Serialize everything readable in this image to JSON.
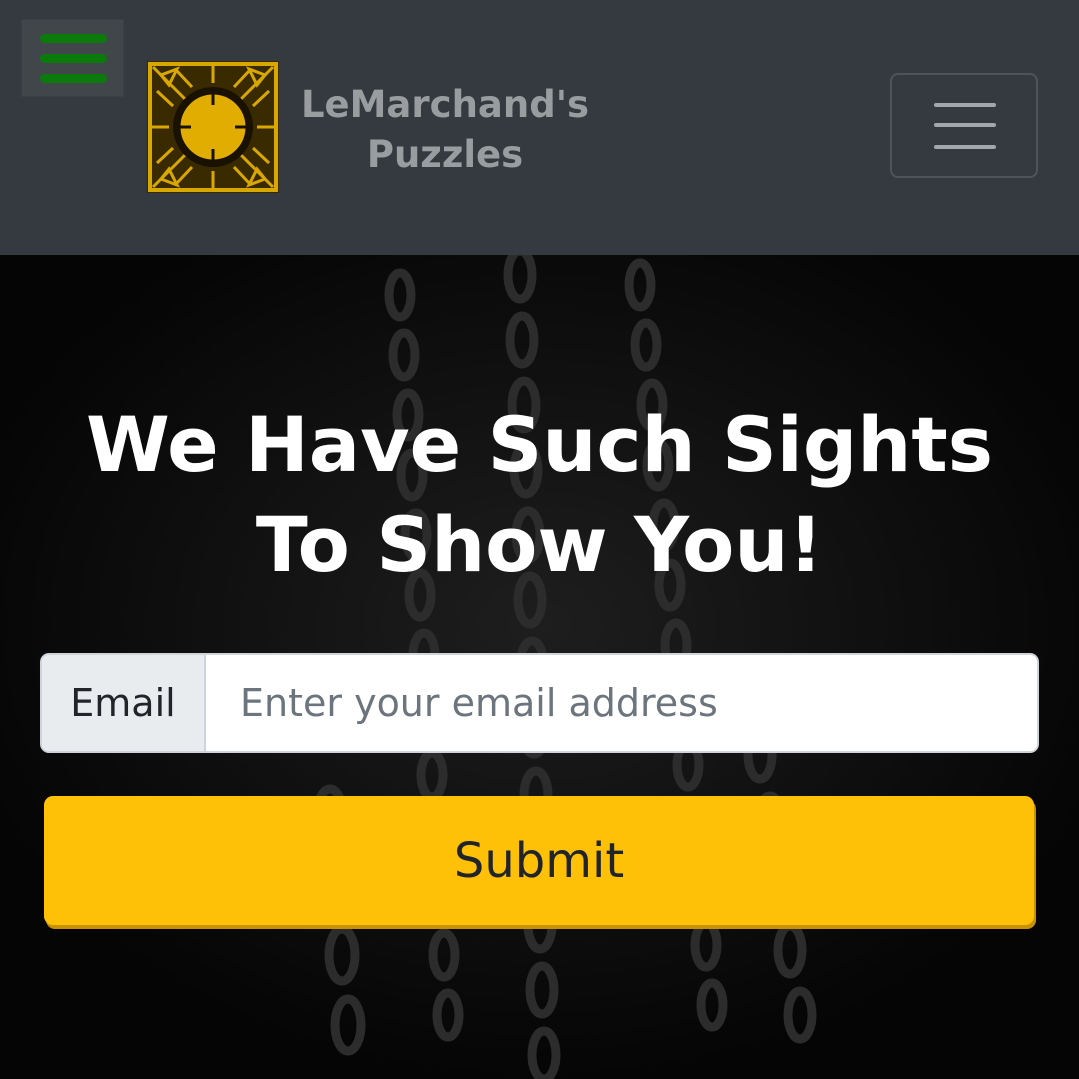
{
  "header": {
    "brand_line1": "LeMarchand's",
    "brand_line2": "Puzzles",
    "logo_icon": "puzzle-box-icon",
    "side_menu_icon": "hamburger-icon",
    "nav_toggle_icon": "hamburger-icon"
  },
  "hero": {
    "headline": "We Have Such Sights To Show You!",
    "email": {
      "label": "Email",
      "placeholder": "Enter your email address",
      "value": ""
    },
    "submit_label": "Submit"
  },
  "colors": {
    "navbar": "#343a40",
    "side_menu_bars": "#0a7a0a",
    "button": "#ffc107",
    "logo_gold": "#d9a800"
  }
}
